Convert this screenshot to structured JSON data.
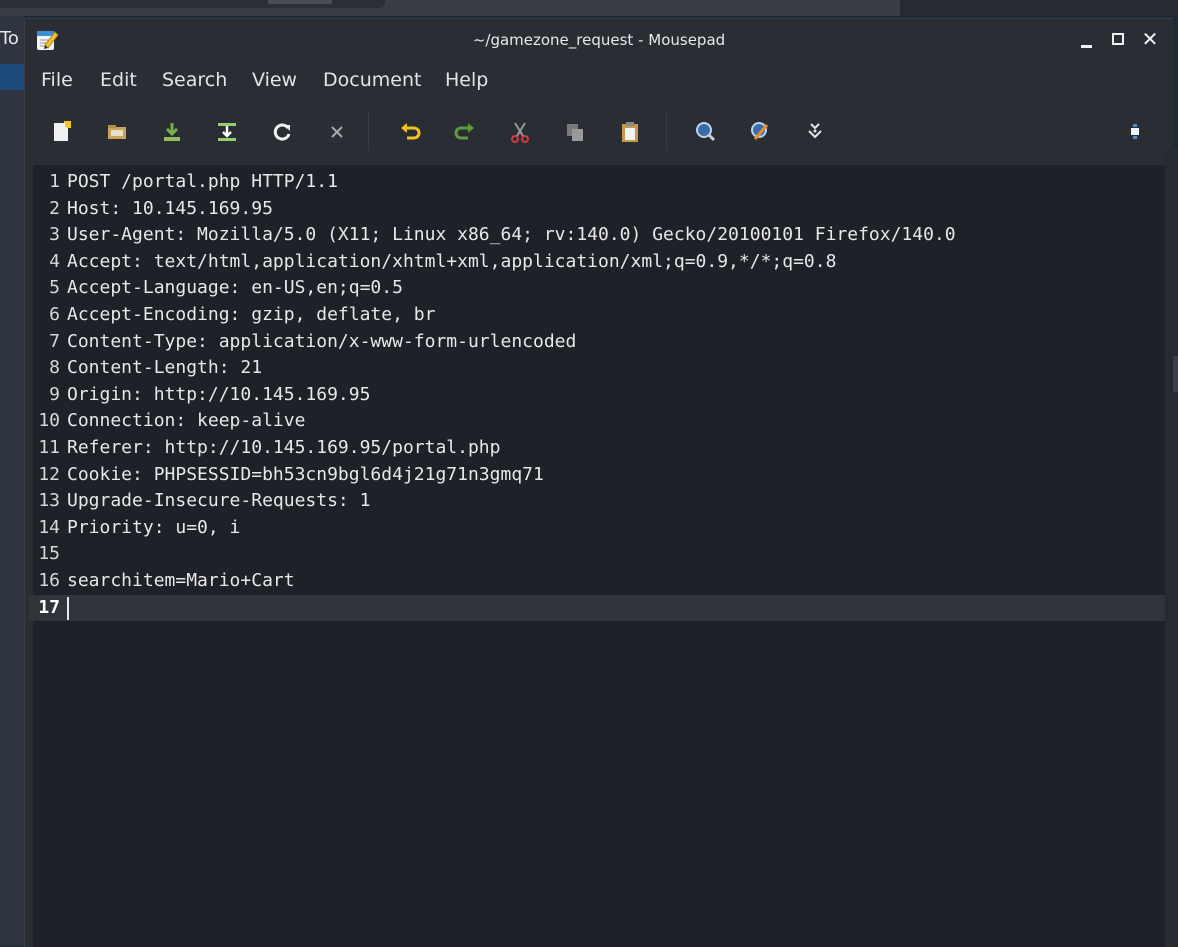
{
  "background": {
    "left_window_text": "To"
  },
  "window": {
    "title": "~/gamezone_request - Mousepad",
    "controls": [
      "minimize",
      "maximize",
      "close"
    ]
  },
  "menu": {
    "file": "File",
    "edit": "Edit",
    "search": "Search",
    "view": "View",
    "document": "Document",
    "help": "Help"
  },
  "toolbar": {
    "icons": [
      "new-document-icon",
      "open-folder-icon",
      "save-icon",
      "save-as-icon",
      "reload-icon",
      "close-tab-icon",
      "undo-icon",
      "redo-icon",
      "cut-icon",
      "copy-icon",
      "paste-icon",
      "find-icon",
      "find-replace-icon",
      "go-to-icon",
      "fullscreen-icon"
    ]
  },
  "editor": {
    "current_line": 17,
    "lines": [
      {
        "num": "1",
        "text": "POST /portal.php HTTP/1.1"
      },
      {
        "num": "2",
        "text": "Host: 10.145.169.95"
      },
      {
        "num": "3",
        "text": "User-Agent: Mozilla/5.0 (X11; Linux x86_64; rv:140.0) Gecko/20100101 Firefox/140.0"
      },
      {
        "num": "4",
        "text": "Accept: text/html,application/xhtml+xml,application/xml;q=0.9,*/*;q=0.8"
      },
      {
        "num": "5",
        "text": "Accept-Language: en-US,en;q=0.5"
      },
      {
        "num": "6",
        "text": "Accept-Encoding: gzip, deflate, br"
      },
      {
        "num": "7",
        "text": "Content-Type: application/x-www-form-urlencoded"
      },
      {
        "num": "8",
        "text": "Content-Length: 21"
      },
      {
        "num": "9",
        "text": "Origin: http://10.145.169.95"
      },
      {
        "num": "10",
        "text": "Connection: keep-alive"
      },
      {
        "num": "11",
        "text": "Referer: http://10.145.169.95/portal.php"
      },
      {
        "num": "12",
        "text": "Cookie: PHPSESSID=bh53cn9bgl6d4j21g71n3gmq71"
      },
      {
        "num": "13",
        "text": "Upgrade-Insecure-Requests: 1"
      },
      {
        "num": "14",
        "text": "Priority: u=0, i"
      },
      {
        "num": "15",
        "text": ""
      },
      {
        "num": "16",
        "text": "searchitem=Mario+Cart"
      },
      {
        "num": "17",
        "text": ""
      }
    ]
  }
}
